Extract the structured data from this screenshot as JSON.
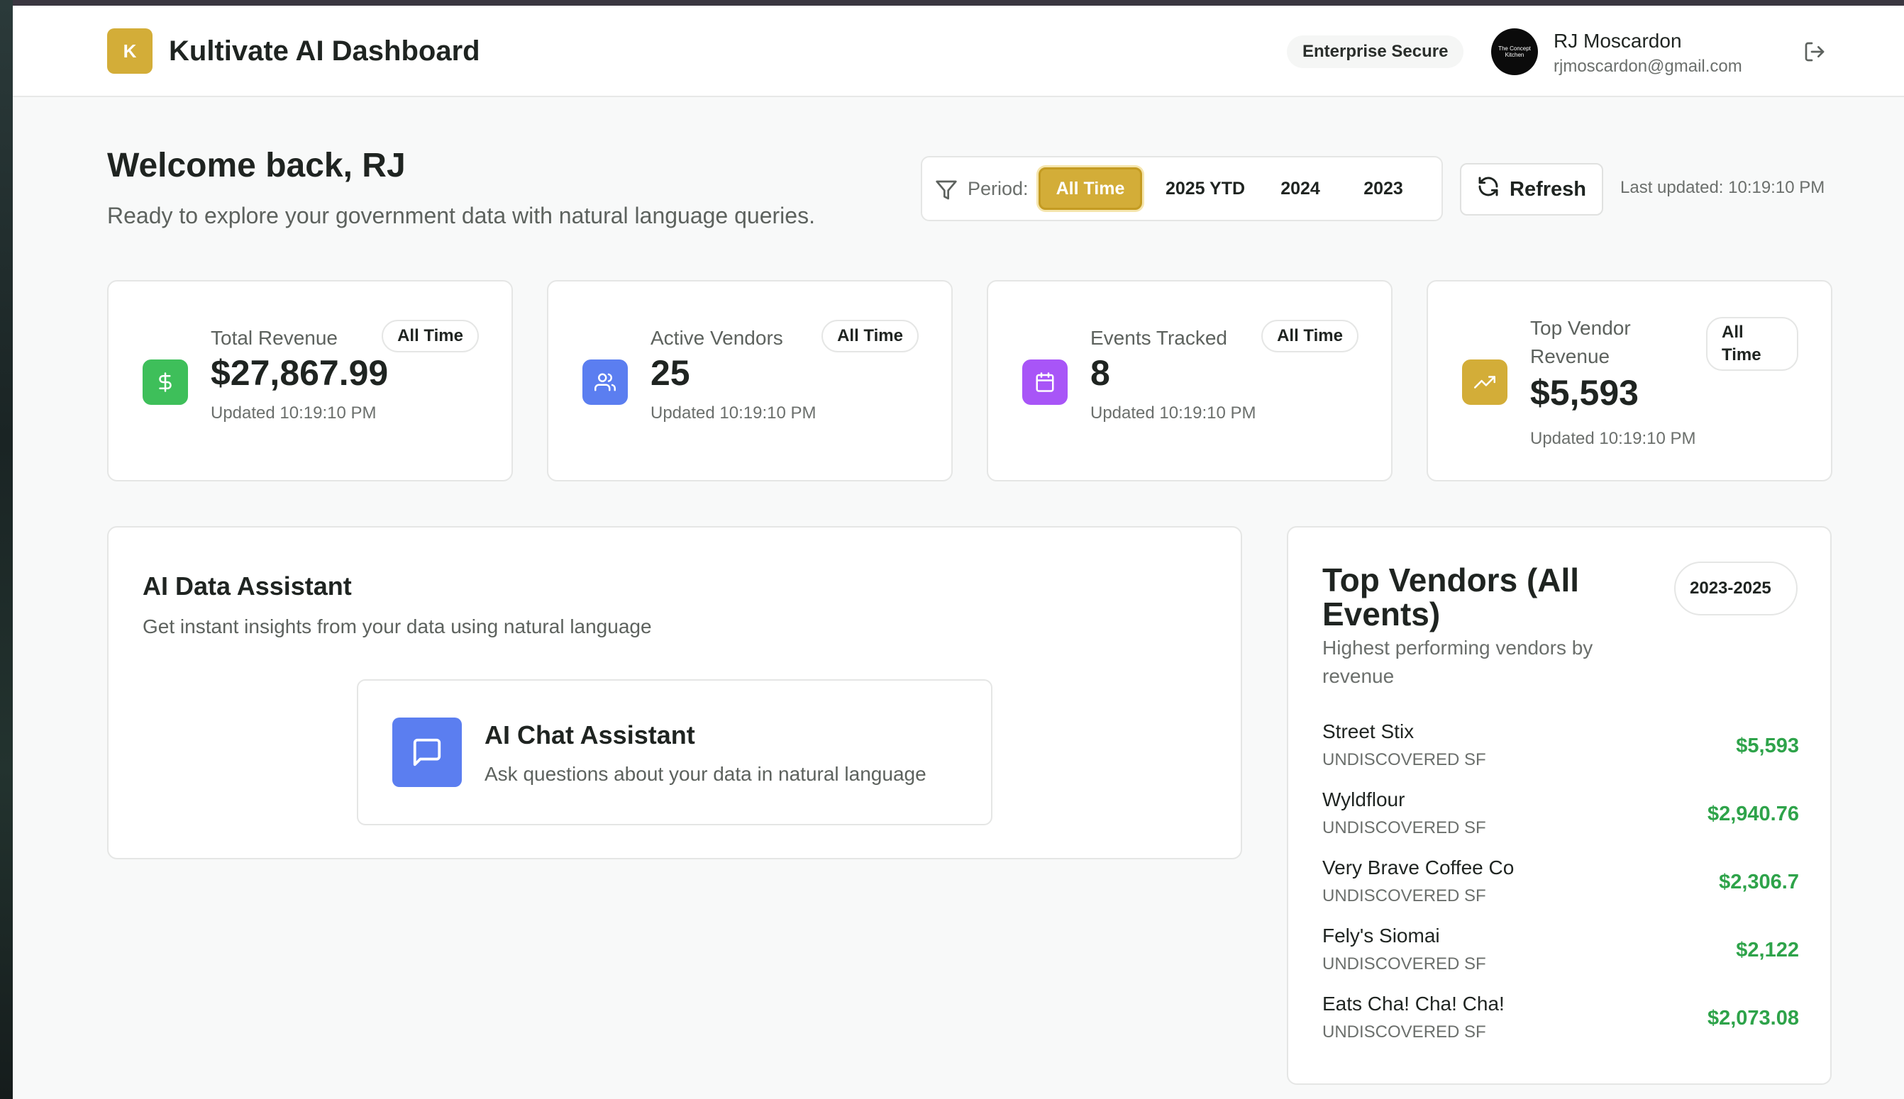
{
  "header": {
    "logo_letter": "K",
    "title": "Kultivate AI Dashboard",
    "security_badge": "Enterprise Secure",
    "avatar_text": "The Concept Kitchen",
    "user_name": "RJ Moscardon",
    "user_email": "rjmoscardon@gmail.com"
  },
  "welcome": {
    "title": "Welcome back, RJ",
    "subtitle": "Ready to explore your government data with natural language queries."
  },
  "period": {
    "label": "Period:",
    "options": [
      "All Time",
      "2025 YTD",
      "2024",
      "2023"
    ],
    "selected": "All Time"
  },
  "refresh_label": "Refresh",
  "last_updated": "Last updated: 10:19:10 PM",
  "stats": [
    {
      "title": "Total Revenue",
      "value": "$27,867.99",
      "pill": "All Time",
      "updated": "Updated 10:19:10 PM",
      "icon": "dollar-icon",
      "color": "#3ebf5a"
    },
    {
      "title": "Active Vendors",
      "value": "25",
      "pill": "All Time",
      "updated": "Updated 10:19:10 PM",
      "icon": "users-icon",
      "color": "#5b7ef0"
    },
    {
      "title": "Events Tracked",
      "value": "8",
      "pill": "All Time",
      "updated": "Updated 10:19:10 PM",
      "icon": "calendar-icon",
      "color": "#a855f7"
    },
    {
      "title": "Top Vendor Revenue",
      "value": "$5,593",
      "pill": "All Time",
      "updated": "Updated 10:19:10 PM",
      "icon": "trending-up-icon",
      "color": "#d3ad38"
    }
  ],
  "assistant": {
    "title": "AI Data Assistant",
    "subtitle": "Get instant insights from your data using natural language",
    "chat_title": "AI Chat Assistant",
    "chat_subtitle": "Ask questions about your data in natural language"
  },
  "vendors": {
    "title": "Top Vendors (All Events)",
    "subtitle": "Highest performing vendors by revenue",
    "pill": "2023-2025",
    "items": [
      {
        "name": "Street Stix",
        "location": "UNDISCOVERED SF",
        "amount": "$5,593"
      },
      {
        "name": "Wyldflour",
        "location": "UNDISCOVERED SF",
        "amount": "$2,940.76"
      },
      {
        "name": "Very Brave Coffee Co",
        "location": "UNDISCOVERED SF",
        "amount": "$2,306.7"
      },
      {
        "name": "Fely's Siomai",
        "location": "UNDISCOVERED SF",
        "amount": "$2,122"
      },
      {
        "name": "Eats Cha! Cha! Cha!",
        "location": "UNDISCOVERED SF",
        "amount": "$2,073.08"
      }
    ]
  },
  "colors": {
    "brand_gold": "#d3ad38",
    "success_green": "#2ea34a"
  }
}
